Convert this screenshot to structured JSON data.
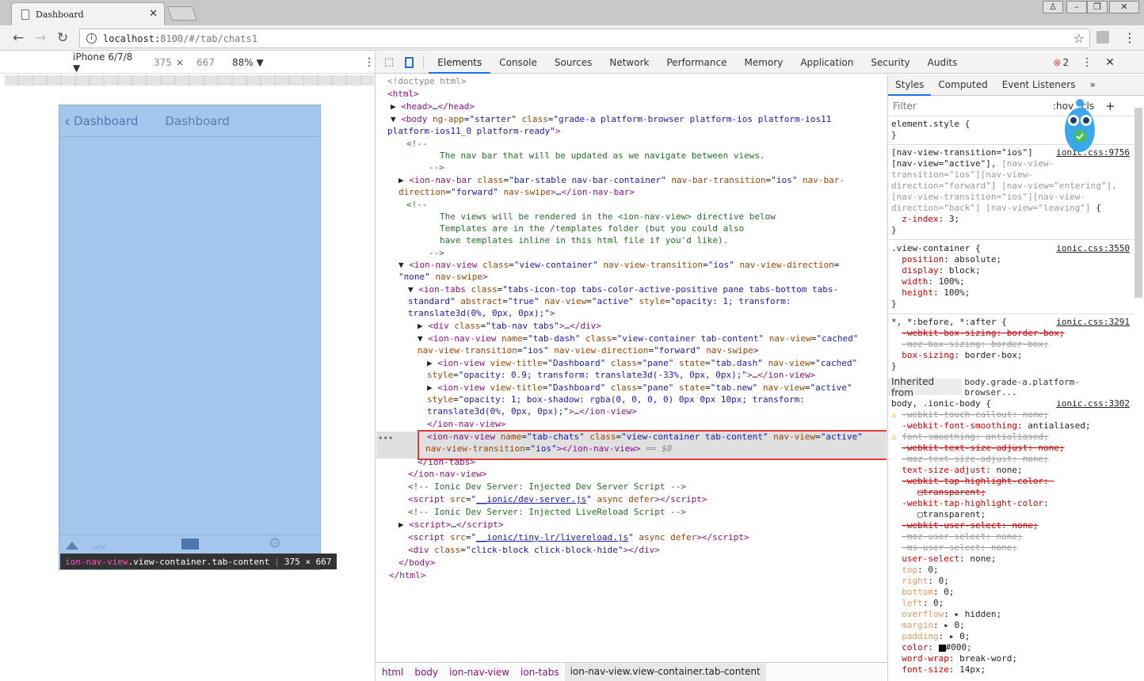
{
  "browser": {
    "tab_title": "Dashboard",
    "url_host": "localhost:",
    "url_rest": "8100/#/tab/chats1"
  },
  "device": {
    "model": "iPhone 6/7/8 ▼",
    "width": "375",
    "times": "×",
    "height": "667",
    "zoom": "88% ▼"
  },
  "app": {
    "back_label": "Dashboard",
    "nav_title": "Dashboard",
    "tooltip_tag": "ion-nav-view",
    "tooltip_class": ".view-container.tab-content",
    "tooltip_size": "375 × 667"
  },
  "devtools": {
    "tabs": [
      "Elements",
      "Console",
      "Sources",
      "Network",
      "Performance",
      "Memory",
      "Application",
      "Security",
      "Audits"
    ],
    "error_count": "2",
    "breadcrumb": [
      "html",
      "body",
      "ion-nav-view",
      "ion-tabs",
      "ion-nav-view.view-container.tab-content"
    ]
  },
  "styles": {
    "tabs": [
      "Styles",
      "Computed",
      "Event Listeners",
      "»"
    ],
    "filter_placeholder": "Filter",
    "filter_hov": ":hov",
    "filter_cls": ".cls",
    "inherited_label": "Inherited from",
    "inherited_selector": "body.grade-a.platform-browser..."
  },
  "colors": {
    "phone_bg": "#a4c6ec",
    "highlight_box": "#e53935",
    "tag_color": "#881280",
    "attr_color": "#994500",
    "value_color": "#1a1aa6"
  }
}
